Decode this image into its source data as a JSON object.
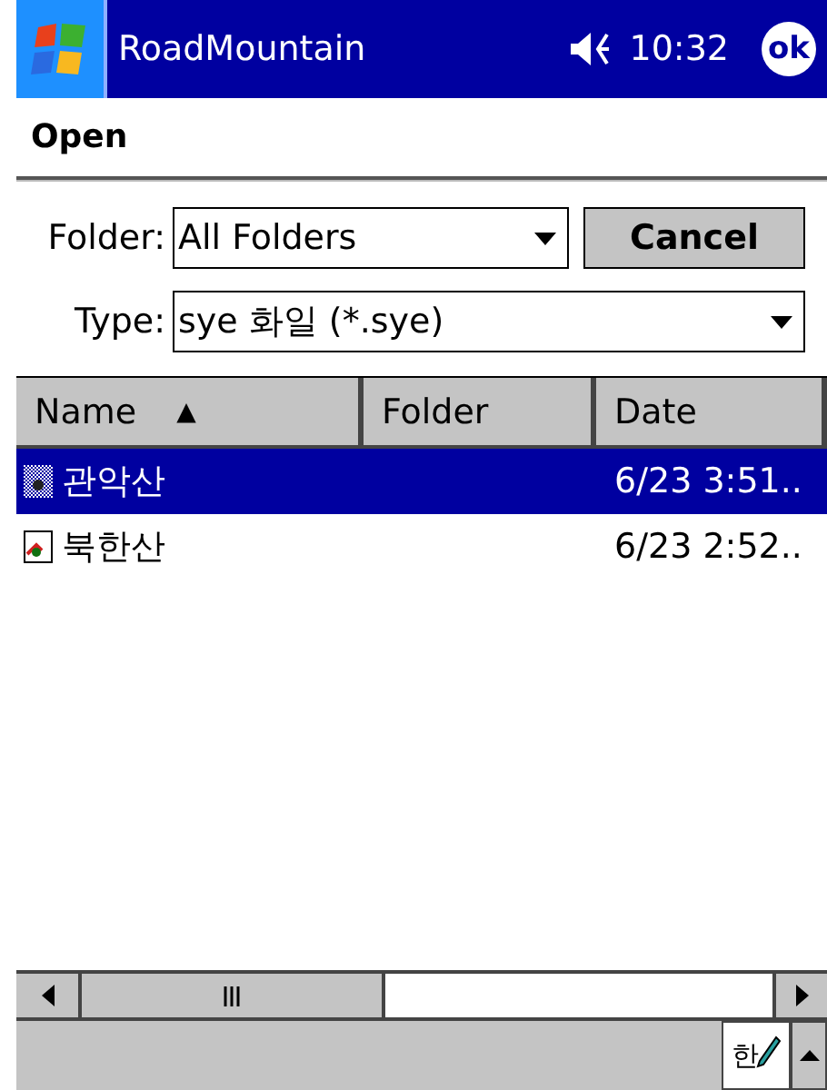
{
  "title_bar": {
    "title": "RoadMountain",
    "time": "10:32",
    "ok_label": "ok"
  },
  "header": {
    "title": "Open"
  },
  "folder": {
    "label": "Folder:",
    "value": "All Folders"
  },
  "cancel_button": {
    "label": "Cancel"
  },
  "type": {
    "label": "Type:",
    "value": "sye 화일 (*.sye)"
  },
  "file_list": {
    "columns": [
      {
        "label": "Name",
        "sort_indicator": "▲"
      },
      {
        "label": "Folder"
      },
      {
        "label": "Date"
      }
    ],
    "rows": [
      {
        "name": "관악산",
        "folder": "",
        "date": "6/23 3:51..",
        "selected": true,
        "kind": "checkered"
      },
      {
        "name": "북한산",
        "folder": "",
        "date": "6/23 2:52..",
        "selected": false,
        "kind": "map"
      }
    ]
  },
  "input_panel": {
    "label": "한"
  }
}
